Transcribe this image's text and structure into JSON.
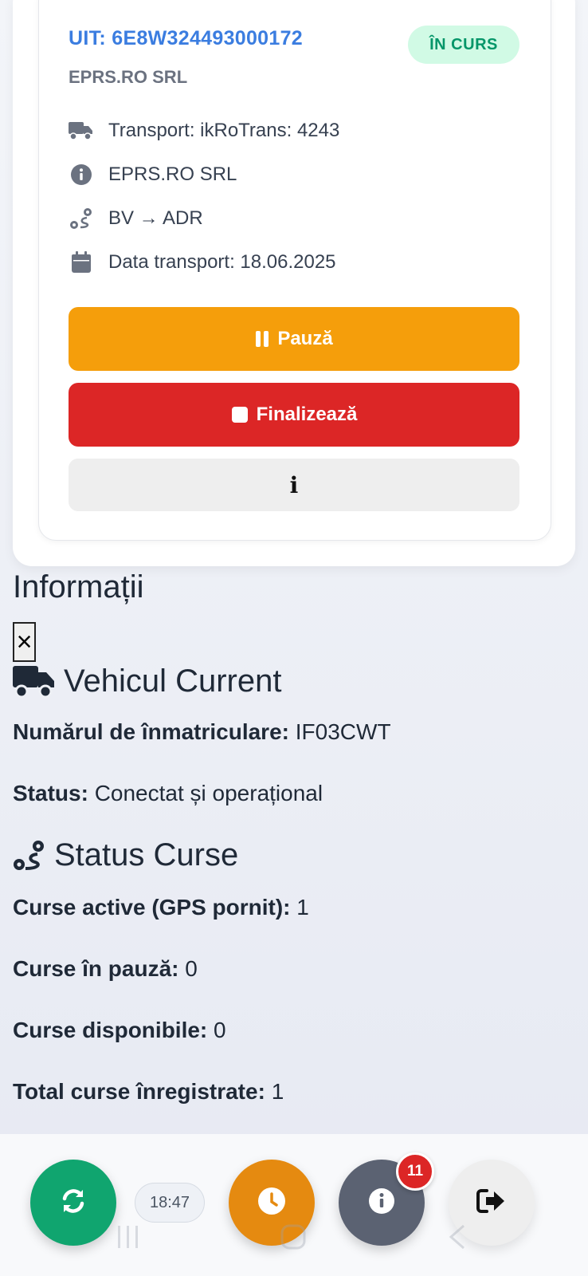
{
  "course_card": {
    "uit": "UIT: 6E8W324493000172",
    "company": "EPRS.RO SRL",
    "status_badge": "ÎN CURS",
    "details": {
      "transport": "Transport: ikRoTrans: 4243",
      "company": "EPRS.RO SRL",
      "route": "BV → ADR",
      "date": "Data transport: 18.06.2025"
    },
    "buttons": {
      "pause": "Pauză",
      "finish": "Finalizează",
      "info": "i"
    }
  },
  "info_panel": {
    "heading": "Informații",
    "close": "×",
    "vehicle": {
      "title": "Vehicul Current",
      "plate_label": "Numărul de înmatriculare:",
      "plate_value": "IF03CWT",
      "status_label": "Status:",
      "status_value": "Conectat și operațional"
    },
    "courses": {
      "title": "Status Curse",
      "active_label": "Curse active (GPS pornit):",
      "active_value": "1",
      "paused_label": "Curse în pauză:",
      "paused_value": "0",
      "available_label": "Curse disponibile:",
      "available_value": "0",
      "total_label": "Total curse înregistrate:",
      "total_value": "1"
    }
  },
  "bottom_bar": {
    "time": "18:47",
    "notification_count": "11",
    "icons": [
      "refresh-icon",
      "clock-icon",
      "info-icon",
      "logout-icon"
    ]
  },
  "colors": {
    "accent_blue": "#3b7de0",
    "pause_orange": "#f59e0b",
    "finish_red": "#dc2626",
    "badge_green": "#059669",
    "refresh_green": "#10a56f"
  }
}
